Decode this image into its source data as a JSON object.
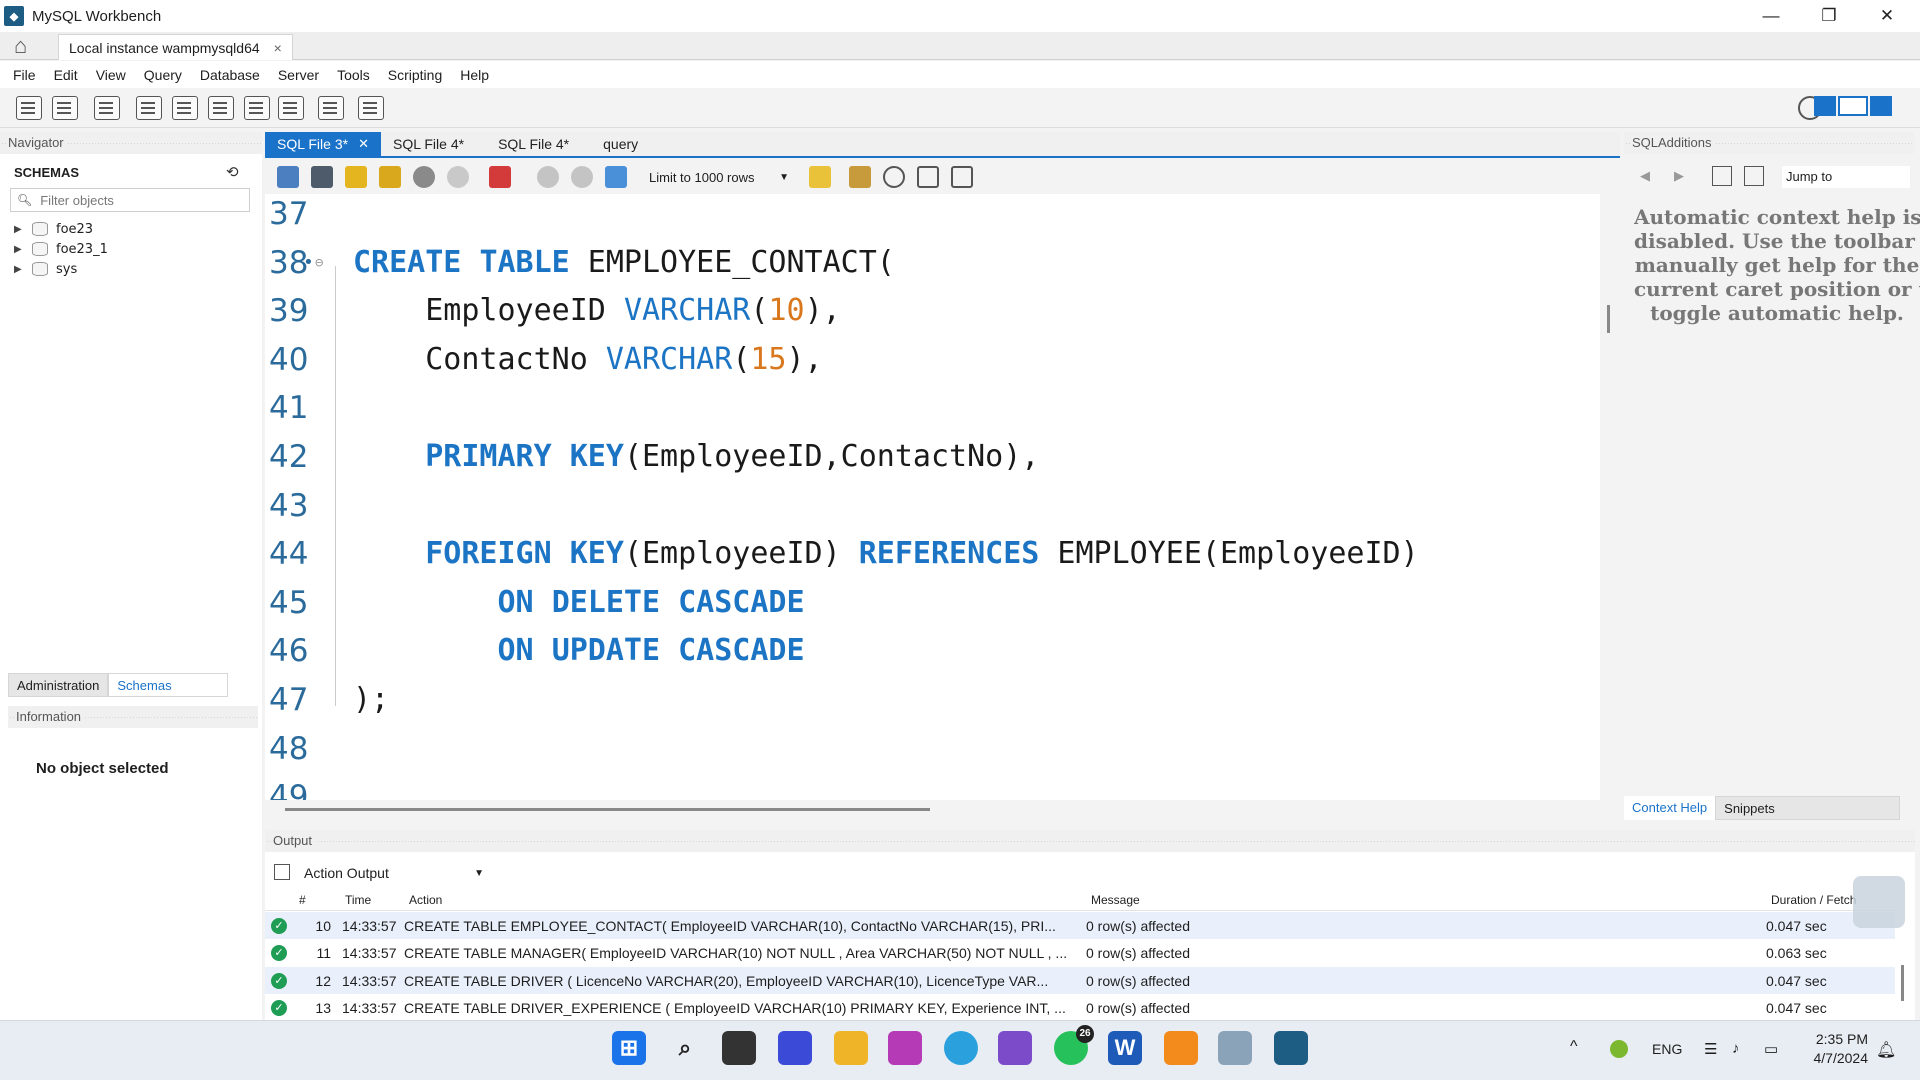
{
  "window": {
    "title": "MySQL Workbench",
    "minimize": "—",
    "restore": "❐",
    "close": "✕"
  },
  "instance_tab": {
    "label": "Local instance wampmysqld64",
    "close": "×"
  },
  "menu": [
    "File",
    "Edit",
    "View",
    "Query",
    "Database",
    "Server",
    "Tools",
    "Scripting",
    "Help"
  ],
  "navigator": {
    "header": "Navigator",
    "schemas_label": "SCHEMAS",
    "filter_placeholder": "Filter objects",
    "schemas": [
      "foe23",
      "foe23_1",
      "sys"
    ],
    "tabs": [
      "Administration",
      "Schemas"
    ],
    "info_header": "Information",
    "no_object": "No object selected"
  },
  "editor": {
    "tabs": [
      {
        "label": "SQL File 3*",
        "active": true
      },
      {
        "label": "SQL File 4*",
        "active": false
      },
      {
        "label": "SQL File 4*",
        "active": false
      },
      {
        "label": "query",
        "active": false
      }
    ],
    "limit_select": "Limit to 1000 rows",
    "lines": [
      {
        "no": "37",
        "tokens": []
      },
      {
        "no": "38",
        "marker": "•",
        "tokens": [
          [
            "kw",
            "CREATE"
          ],
          [
            "pl",
            " "
          ],
          [
            "kw",
            "TABLE"
          ],
          [
            "pl",
            " EMPLOYEE_CONTACT("
          ]
        ]
      },
      {
        "no": "39",
        "tokens": [
          [
            "pl",
            "    EmployeeID "
          ],
          [
            "tp",
            "VARCHAR"
          ],
          [
            "pl",
            "("
          ],
          [
            "num",
            "10"
          ],
          [
            "pl",
            "),"
          ]
        ]
      },
      {
        "no": "40",
        "tokens": [
          [
            "pl",
            "    ContactNo "
          ],
          [
            "tp",
            "VARCHAR"
          ],
          [
            "pl",
            "("
          ],
          [
            "num",
            "15"
          ],
          [
            "pl",
            "),"
          ]
        ]
      },
      {
        "no": "41",
        "tokens": []
      },
      {
        "no": "42",
        "tokens": [
          [
            "pl",
            "    "
          ],
          [
            "kw",
            "PRIMARY"
          ],
          [
            "pl",
            " "
          ],
          [
            "kw",
            "KEY"
          ],
          [
            "pl",
            "(EmployeeID,ContactNo),"
          ]
        ]
      },
      {
        "no": "43",
        "tokens": []
      },
      {
        "no": "44",
        "tokens": [
          [
            "pl",
            "    "
          ],
          [
            "kw",
            "FOREIGN"
          ],
          [
            "pl",
            " "
          ],
          [
            "kw",
            "KEY"
          ],
          [
            "pl",
            "(EmployeeID) "
          ],
          [
            "kw",
            "REFERENCES"
          ],
          [
            "pl",
            " EMPLOYEE(EmployeeID)"
          ]
        ]
      },
      {
        "no": "45",
        "tokens": [
          [
            "pl",
            "        "
          ],
          [
            "kw",
            "ON"
          ],
          [
            "pl",
            " "
          ],
          [
            "kw",
            "DELETE"
          ],
          [
            "pl",
            " "
          ],
          [
            "kw",
            "CASCADE"
          ]
        ]
      },
      {
        "no": "46",
        "tokens": [
          [
            "pl",
            "        "
          ],
          [
            "kw",
            "ON"
          ],
          [
            "pl",
            " "
          ],
          [
            "kw",
            "UPDATE"
          ],
          [
            "pl",
            " "
          ],
          [
            "kw",
            "CASCADE"
          ]
        ]
      },
      {
        "no": "47",
        "tokens": [
          [
            "pl",
            ");"
          ]
        ]
      },
      {
        "no": "48",
        "tokens": []
      },
      {
        "no": "49",
        "tokens": []
      }
    ]
  },
  "additions": {
    "header": "SQLAdditions",
    "jump_to": "Jump to",
    "help_text": "Automatic context help is\ndisabled. Use the toolbar to\nmanually get help for the\ncurrent caret position or to\ntoggle automatic help.",
    "tabs": [
      "Context Help",
      "Snippets"
    ]
  },
  "output": {
    "header": "Output",
    "select": "Action Output",
    "columns": [
      "#",
      "Time",
      "Action",
      "Message",
      "Duration / Fetch"
    ],
    "rows": [
      {
        "n": "10",
        "time": "14:33:57",
        "action": "CREATE TABLE EMPLOYEE_CONTACT(    EmployeeID VARCHAR(10),    ContactNo VARCHAR(15),    PRI...",
        "message": "0 row(s) affected",
        "duration": "0.047 sec"
      },
      {
        "n": "11",
        "time": "14:33:57",
        "action": "CREATE TABLE MANAGER(    EmployeeID VARCHAR(10) NOT NULL ,    Area VARCHAR(50) NOT NULL ,  ...",
        "message": "0 row(s) affected",
        "duration": "0.063 sec"
      },
      {
        "n": "12",
        "time": "14:33:57",
        "action": "CREATE TABLE DRIVER (    LicenceNo VARCHAR(20),    EmployeeID VARCHAR(10),    LicenceType VAR...",
        "message": "0 row(s) affected",
        "duration": "0.047 sec"
      },
      {
        "n": "13",
        "time": "14:33:57",
        "action": "CREATE TABLE DRIVER_EXPERIENCE (    EmployeeID VARCHAR(10) PRIMARY KEY,    Experience INT,  ...",
        "message": "0 row(s) affected",
        "duration": "0.047 sec"
      }
    ]
  },
  "taskbar": {
    "whatsapp_badge": "26",
    "lang": "ENG",
    "time": "2:35 PM",
    "date": "4/7/2024"
  },
  "colors": {
    "accent": "#1a73c9",
    "keyword": "#1c74c4",
    "number": "#d9771c",
    "line_number": "#2b6b9c"
  }
}
